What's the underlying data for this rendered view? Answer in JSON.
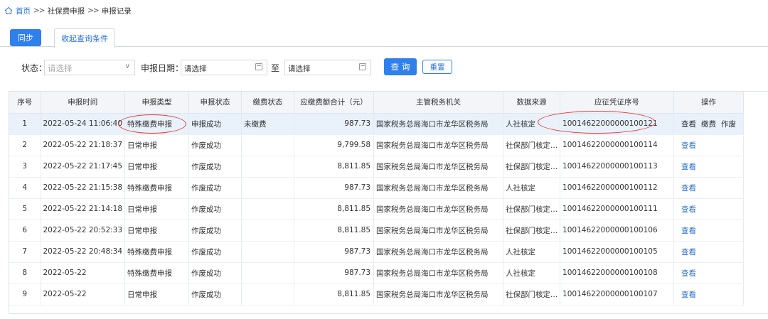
{
  "breadcrumb": {
    "home": "首页",
    "sep": ">>",
    "level1": "社保费申报",
    "level2": "申报记录"
  },
  "toolbar": {
    "sync_label": "同步",
    "collapse_label": "收起查询条件"
  },
  "filters": {
    "status_label": "状态：",
    "status_placeholder": "请选择",
    "date_label": "申报日期：",
    "date_from": "请选择",
    "to_label": "至",
    "date_to": "请选择",
    "query_label": "查 询",
    "reset_label": "重置"
  },
  "table": {
    "columns": [
      "序号",
      "申报时间",
      "申报类型",
      "申报状态",
      "缴费状态",
      "应缴费额合计（元）",
      "主管税务机关",
      "数据来源",
      "应征凭证序号",
      "操作"
    ],
    "rows": [
      {
        "no": "1",
        "time": "2022-05-24 11:06:40",
        "type": "特殊缴费申报",
        "status": "申报成功",
        "pay": "未缴费",
        "amount": "987.73",
        "office": "国家税务总局海口市龙华区税务局",
        "source": "人社核定",
        "voucher": "10014622000000100121",
        "actions": [
          "查看",
          "缴费",
          "作废"
        ]
      },
      {
        "no": "2",
        "time": "2022-05-22 21:18:37",
        "type": "日常申报",
        "status": "作废成功",
        "pay": "",
        "amount": "9,799.58",
        "office": "国家税务总局海口市龙华区税务局",
        "source": "社保部门核定...",
        "voucher": "10014622000000100114",
        "actions": [
          "查看"
        ]
      },
      {
        "no": "3",
        "time": "2022-05-22 21:17:45",
        "type": "日常申报",
        "status": "作废成功",
        "pay": "",
        "amount": "8,811.85",
        "office": "国家税务总局海口市龙华区税务局",
        "source": "社保部门核定...",
        "voucher": "10014622000000100113",
        "actions": [
          "查看"
        ]
      },
      {
        "no": "4",
        "time": "2022-05-22 21:15:38",
        "type": "特殊缴费申报",
        "status": "作废成功",
        "pay": "",
        "amount": "987.73",
        "office": "国家税务总局海口市龙华区税务局",
        "source": "人社核定",
        "voucher": "10014622000000100112",
        "actions": [
          "查看"
        ]
      },
      {
        "no": "5",
        "time": "2022-05-22 21:14:18",
        "type": "日常申报",
        "status": "作废成功",
        "pay": "",
        "amount": "8,811.85",
        "office": "国家税务总局海口市龙华区税务局",
        "source": "社保部门核定...",
        "voucher": "10014622000000100111",
        "actions": [
          "查看"
        ]
      },
      {
        "no": "6",
        "time": "2022-05-22 20:52:33",
        "type": "日常申报",
        "status": "作废成功",
        "pay": "",
        "amount": "8,811.85",
        "office": "国家税务总局海口市龙华区税务局",
        "source": "社保部门核定...",
        "voucher": "10014622000000100106",
        "actions": [
          "查看"
        ]
      },
      {
        "no": "7",
        "time": "2022-05-22 20:48:34",
        "type": "特殊缴费申报",
        "status": "作废成功",
        "pay": "",
        "amount": "987.73",
        "office": "国家税务总局海口市龙华区税务局",
        "source": "人社核定",
        "voucher": "10014622000000100105",
        "actions": [
          "查看"
        ]
      },
      {
        "no": "8",
        "time": "2022-05-22",
        "type": "特殊缴费申报",
        "status": "作废成功",
        "pay": "",
        "amount": "987.73",
        "office": "国家税务总局海口市龙华区税务局",
        "source": "人社核定",
        "voucher": "10014622000000100108",
        "actions": [
          "查看"
        ]
      },
      {
        "no": "9",
        "time": "2022-05-22",
        "type": "日常申报",
        "status": "作废成功",
        "pay": "",
        "amount": "8,811.85",
        "office": "国家税务总局海口市龙华区税务局",
        "source": "社保部门核定...",
        "voucher": "10014622000000100107",
        "actions": [
          "查看"
        ]
      }
    ]
  },
  "colors": {
    "accent": "#2f80ed",
    "link": "#2a6fd6",
    "header_bg": "#f3f5f8",
    "selected_row": "#e9f1fb",
    "annotation": "#e53935"
  },
  "icons": {
    "home": "home-icon",
    "select": "chevron-down-icon",
    "date": "calendar-icon"
  }
}
